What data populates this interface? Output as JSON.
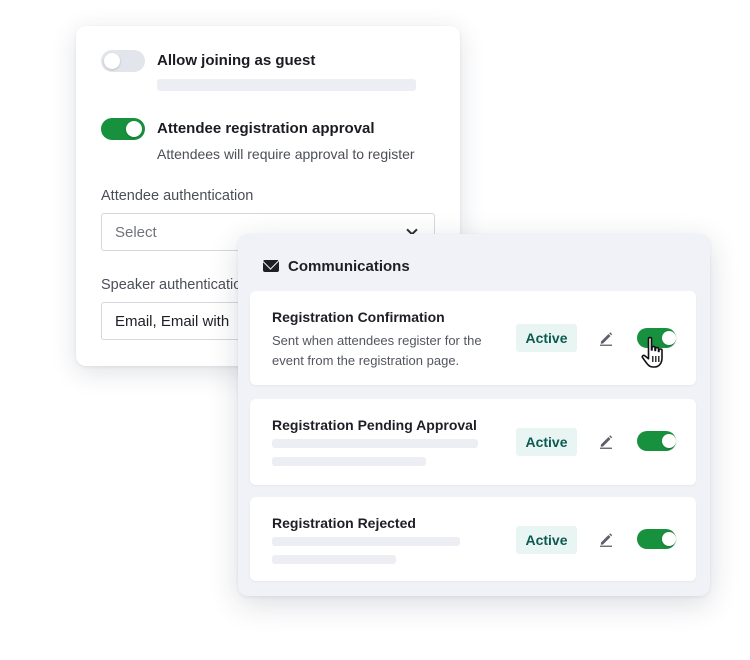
{
  "settings": {
    "guest": {
      "title": "Allow joining as guest",
      "enabled": false
    },
    "approval": {
      "title": "Attendee registration approval",
      "description": "Attendees will require approval to register",
      "enabled": true
    },
    "attendee_auth": {
      "label": "Attendee authentication",
      "placeholder": "Select"
    },
    "speaker_auth": {
      "label": "Speaker authentication",
      "value": "Email, Email with"
    }
  },
  "communications": {
    "title": "Communications",
    "icon": "mail-icon",
    "items": [
      {
        "title": "Registration Confirmation",
        "description": "Sent when attendees register for the event from the registration page.",
        "status": "Active",
        "enabled": true
      },
      {
        "title": "Registration Pending Approval",
        "status": "Active",
        "enabled": true
      },
      {
        "title": "Registration Rejected",
        "status": "Active",
        "enabled": true
      }
    ]
  },
  "colors": {
    "toggle_on": "#17913d",
    "toggle_off": "#e2e5ec",
    "badge_bg": "#e9f5f3",
    "badge_text": "#0e5a52"
  }
}
